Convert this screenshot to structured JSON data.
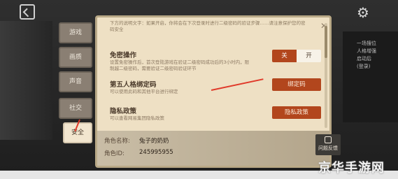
{
  "top_description": "下方的说明文字：如果开启，你将会在下次登录时进行二级密码的验证步骤……请注意保护您的密码安全",
  "tabs": [
    {
      "label": "游戏"
    },
    {
      "label": "画质"
    },
    {
      "label": "声音"
    },
    {
      "label": "社交"
    },
    {
      "label": "安全",
      "active": true
    }
  ],
  "sections": {
    "password_free": {
      "title": "免密操作",
      "desc": "设置免密操作后，首次登陆游戏在验证二级密码成功后的3小时内，限制越二级密码，需要验证二级密码验证环节",
      "toggle_off_label": "关",
      "toggle_on_label": "开",
      "selected": "关"
    },
    "binding": {
      "title": "第五人格绑定码",
      "desc": "可以使用此码和其他平台进行绑定",
      "button_label": "绑定码"
    },
    "privacy": {
      "title": "隐私政策",
      "desc": "可以查看网易集团隐私政策",
      "button_label": "隐私政策"
    }
  },
  "footer": {
    "name_label": "角色名称:",
    "name_value": "兔子的奶奶",
    "id_label": "角色ID:",
    "id_value": "245995955",
    "feedback_label": "问题反馈"
  },
  "right_panel_lines": [
    "一场搜位",
    "人格增强",
    "启动后",
    "(登录)"
  ],
  "watermark": "京华手游网",
  "colors": {
    "accent": "#b2461d",
    "panel_bg": "#eee0c4",
    "arrow": "#e03a2a"
  },
  "icons": [
    "back-icon",
    "gear-icon",
    "close-icon",
    "edit-icon"
  ]
}
